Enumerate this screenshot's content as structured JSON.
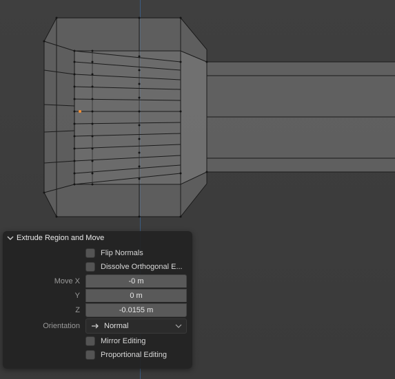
{
  "panel": {
    "title": "Extrude Region and Move",
    "flip_normals_label": "Flip Normals",
    "dissolve_label": "Dissolve Orthogonal E...",
    "move_x_label": "Move X",
    "move_x_value": "-0 m",
    "y_label": "Y",
    "y_value": "0 m",
    "z_label": "Z",
    "z_value": "-0.0155 m",
    "orientation_label": "Orientation",
    "orientation_value": "Normal",
    "mirror_label": "Mirror Editing",
    "proportional_label": "Proportional Editing"
  }
}
